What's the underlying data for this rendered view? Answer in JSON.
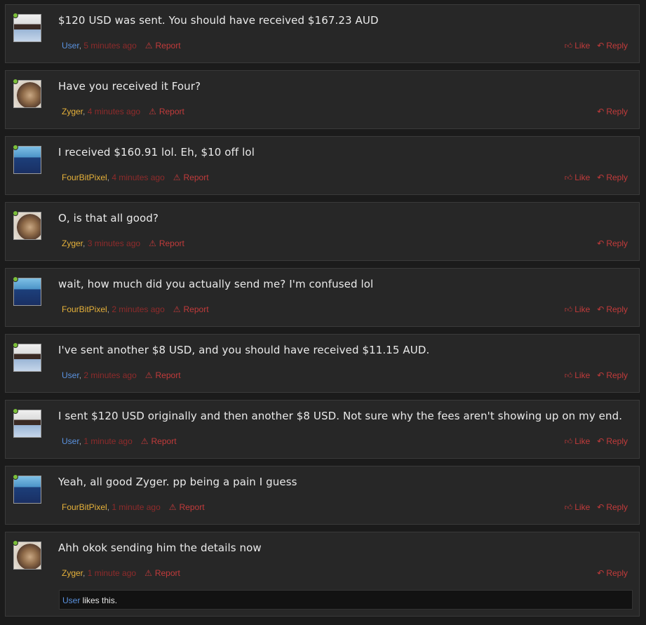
{
  "labels": {
    "like": "Like",
    "reply": "Reply",
    "report": "Report",
    "likes_this": " likes this.",
    "comma": ", "
  },
  "icons": {
    "like": "thumbs-up-icon",
    "reply": "reply-arrow-icon",
    "report": "warning-triangle-icon",
    "online": "online-status-icon"
  },
  "colors": {
    "user": "#5b93e0",
    "gold": "#e6b13a",
    "action": "#c23b3b",
    "time": "#8f2b2b"
  },
  "comments": [
    {
      "author": "User",
      "time": "5 minutes ago",
      "text": "$120 USD was sent. You should have received $167.23 AUD",
      "show_like": true
    },
    {
      "author": "Zyger",
      "time": "4 minutes ago",
      "text": "Have you received it Four?",
      "show_like": false
    },
    {
      "author": "FourBitPixel",
      "time": "4 minutes ago",
      "text": "I received $160.91 lol. Eh, $10 off lol",
      "show_like": true
    },
    {
      "author": "Zyger",
      "time": "3 minutes ago",
      "text": "O, is that all good?",
      "show_like": false
    },
    {
      "author": "FourBitPixel",
      "time": "2 minutes ago",
      "text": "wait, how much did you actually send me? I'm confused lol",
      "show_like": true
    },
    {
      "author": "User",
      "time": "2 minutes ago",
      "text": "I've sent another $8 USD, and you should have received $11.15 AUD.",
      "show_like": true
    },
    {
      "author": "User",
      "time": "1 minute ago",
      "text": "I sent $120 USD originally and then another $8 USD. Not sure why the fees aren't showing up on my end.",
      "show_like": true
    },
    {
      "author": "FourBitPixel",
      "time": "1 minute ago",
      "text": "Yeah, all good Zyger. pp being a pain I guess",
      "show_like": true
    },
    {
      "author": "Zyger",
      "time": "1 minute ago",
      "text": "Ahh okok sending him the details now",
      "show_like": false,
      "liked_by": "User"
    }
  ]
}
